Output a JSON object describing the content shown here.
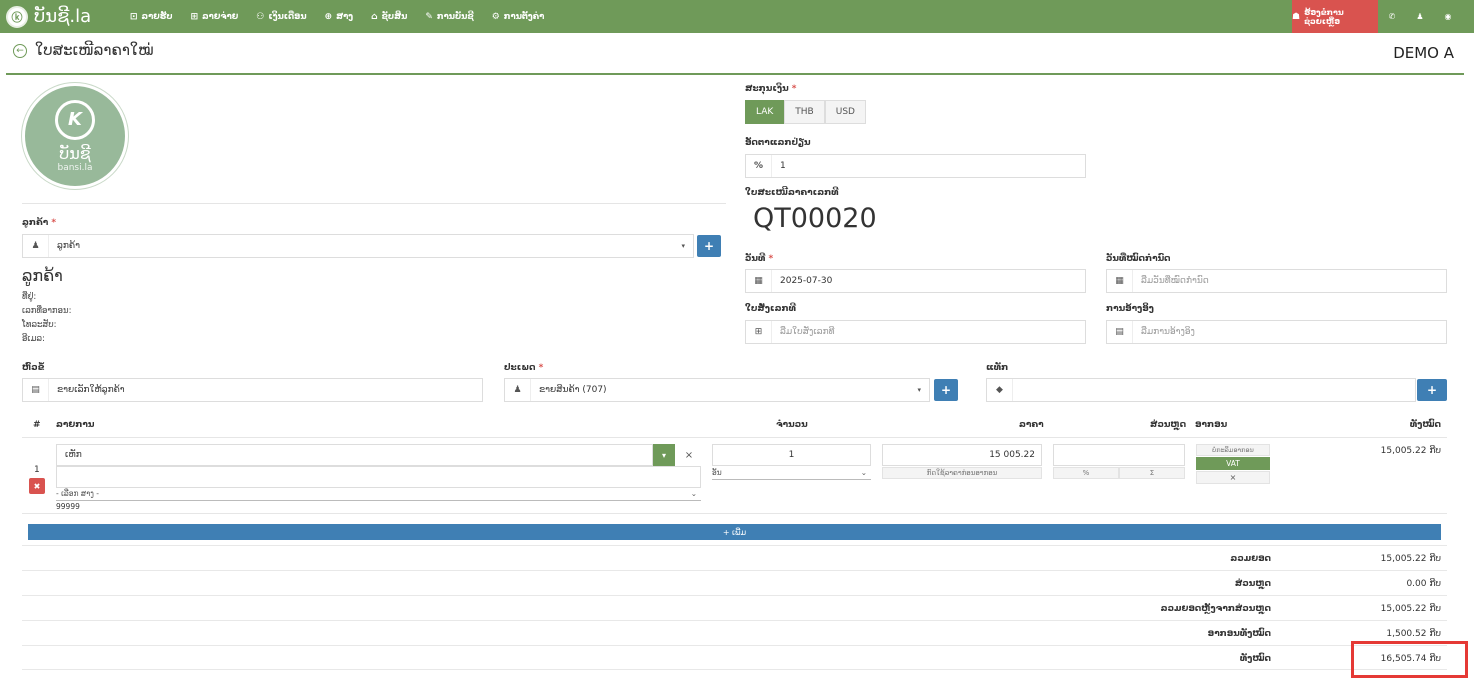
{
  "brand": {
    "name": "ບັນຊີ.la",
    "logo_letter": "K"
  },
  "nav": [
    {
      "icon": "⊡",
      "label": "ລາຍຮັບ"
    },
    {
      "icon": "⊞",
      "label": "ລາຍຈ່າຍ"
    },
    {
      "icon": "⚇",
      "label": "ເງິນເດືອນ"
    },
    {
      "icon": "⊕",
      "label": "ສາງ"
    },
    {
      "icon": "⌂",
      "label": "ຊັບສິນ"
    },
    {
      "icon": "✎",
      "label": "ການບັນຊີ"
    },
    {
      "icon": "⚙",
      "label": "ການຕັ້ງຄ່າ"
    }
  ],
  "topbar_right": {
    "report_label": "ຮ້ອງຂໍການຊ່ວຍເຫຼືອ"
  },
  "page": {
    "title": "ໃບສະເໜີລາຄາໃໝ່",
    "company": "DEMO A"
  },
  "logo_block": {
    "line1": "ບັນຊີ",
    "line2": "bansi.la"
  },
  "customer": {
    "label": "ລູກຄ້າ",
    "req": "*",
    "value": "ລູກຄ້າ",
    "name": "ລູກຄ້າ",
    "address_label": "ທີ່ຢູ່:",
    "tax_label": "ເລກທີ່ອາກອນ:",
    "phone_label": "ໂທລະສັບ:",
    "email_label": "ອີເມລ:"
  },
  "currency": {
    "label": "ສະກຸນເງິນ",
    "req": "*",
    "options": [
      "LAK",
      "THB",
      "USD"
    ],
    "selected": "LAK"
  },
  "exchange": {
    "label": "ອັດຕາແລກປ່ຽນ",
    "addon": "%",
    "value": "1"
  },
  "quote_no": {
    "label": "ໃບສະເໜີລາຄາເລກທີ",
    "value": "QT00020"
  },
  "date": {
    "label": "ວັນທີ",
    "req": "*",
    "value": "2025-07-30"
  },
  "due_date": {
    "label": "ວັນທີ່ໝົດກຳນົດ",
    "placeholder": "ລືມວັນທີ່ໝົດກຳນົດ"
  },
  "po": {
    "label": "ໃບສັ່ງເລກທີ",
    "placeholder": "ລືມໃບສັ່ງເລກທີ"
  },
  "reference": {
    "label": "ການອ້າງອິງ",
    "placeholder": "ລືມການອ້າງອິງ"
  },
  "subject": {
    "label": "ຫົວຂໍ້",
    "placeholder": "ຂາຍເລັກໃຫ້ລູກຄ້າ"
  },
  "type": {
    "label": "ປະເພດ",
    "req": "*",
    "value": "ຂາຍສິນຄ້າ (707)"
  },
  "tags": {
    "label": "ແທັກ"
  },
  "table": {
    "headers": {
      "num": "#",
      "item": "ລາຍການ",
      "qty": "ຈຳນວນ",
      "price": "ລາຄາ",
      "discount": "ສ່ວນຫຼຸດ",
      "tax": "ອາກອນ",
      "total": "ທັງໝົດ"
    },
    "rows": [
      {
        "num": "1",
        "item": "ເຫັກ",
        "warehouse": "- ເລືອກ ສາງ -",
        "code": "99999",
        "qty": "1",
        "unit": "ອັນ",
        "price": "15 005.22",
        "price_note": "ກົດໃຊ້ລາຄາກ່ອນອາກອນ",
        "disc_pct": "%",
        "disc_sum": "Σ",
        "tax_none": "ບໍ່ກະລິມອາກອນ",
        "tax_vat": "VAT",
        "tax_x": "×",
        "total": "15,005.22 ກີບ"
      }
    ],
    "add_label": "+ ເພີ່ມ"
  },
  "totals": [
    {
      "label": "ລວມຍອດ",
      "value": "15,005.22 ກີບ"
    },
    {
      "label": "ສ່ວນຫຼຸດ",
      "value": "0.00 ກີບ"
    },
    {
      "label": "ລວມຍອດຫຼັງຈາກສ່ວນຫຼຸດ",
      "value": "15,005.22 ກີບ"
    },
    {
      "label": "ອາກອນທັງໝົດ",
      "value": "1,500.52 ກີບ"
    },
    {
      "label": "ທັງໝົດ",
      "value": "16,505.74 ກີບ"
    }
  ],
  "colors": {
    "primary_green": "#6f9a59",
    "blue": "#3f7fb4",
    "red": "#d9534f"
  }
}
